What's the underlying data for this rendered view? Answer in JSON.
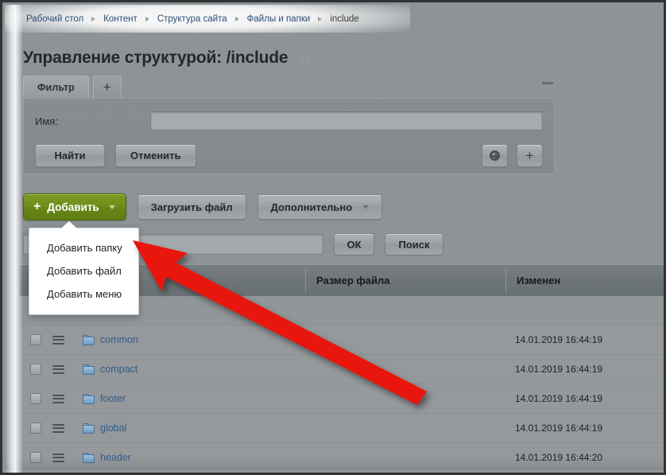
{
  "breadcrumb": {
    "items": [
      {
        "label": "Рабочий стол"
      },
      {
        "label": "Контент"
      },
      {
        "label": "Структура сайта"
      },
      {
        "label": "Файлы и папки"
      },
      {
        "label": "include"
      }
    ]
  },
  "header": {
    "title": "Управление структурой: /include",
    "favorite_icon": "☆"
  },
  "filter": {
    "tabs": [
      {
        "label": "Фильтр",
        "active": true
      },
      {
        "label": "+",
        "active": false
      }
    ],
    "collapse_label": "",
    "name_label": "Имя:",
    "name_value": "",
    "name_placeholder": "",
    "find_label": "Найти",
    "cancel_label": "Отменить",
    "settings_icon": "gear-icon",
    "add_icon": "plus-icon"
  },
  "toolbar": {
    "add_label": "Добавить",
    "add_plus": "+",
    "upload_label": "Загрузить файл",
    "more_label": "Дополнительно"
  },
  "add_menu": {
    "items": [
      {
        "label": "Добавить папку"
      },
      {
        "label": "Добавить файл"
      },
      {
        "label": "Добавить меню"
      }
    ]
  },
  "search": {
    "value": "",
    "placeholder": "",
    "ok_label": "ОК",
    "search_label": "Поиск"
  },
  "table": {
    "columns": [
      {
        "key": "check",
        "label": ""
      },
      {
        "key": "menu",
        "label": ""
      },
      {
        "key": "name",
        "label": ""
      },
      {
        "key": "size",
        "label": "Размер файла"
      },
      {
        "key": "modified",
        "label": "Изменен"
      }
    ],
    "rows": [
      {
        "name": "common",
        "size": "",
        "modified": "14.01.2019 16:44:19",
        "icon": "folder-icon"
      },
      {
        "name": "compact",
        "size": "",
        "modified": "14.01.2019 16:44:19",
        "icon": "folder-icon"
      },
      {
        "name": "footer",
        "size": "",
        "modified": "14.01.2019 16:44:19",
        "icon": "folder-icon"
      },
      {
        "name": "global",
        "size": "",
        "modified": "14.01.2019 16:44:19",
        "icon": "folder-icon"
      },
      {
        "name": "header",
        "size": "",
        "modified": "14.01.2019 16:44:20",
        "icon": "folder-icon"
      }
    ]
  },
  "annotation": {
    "arrow_color": "#e8160d"
  },
  "colors": {
    "page_background": "#8d9396",
    "accent_green": "#6f8d1b",
    "link_blue": "#2f5c8f",
    "table_header": "#6e7578",
    "row_background": "#95999b"
  }
}
